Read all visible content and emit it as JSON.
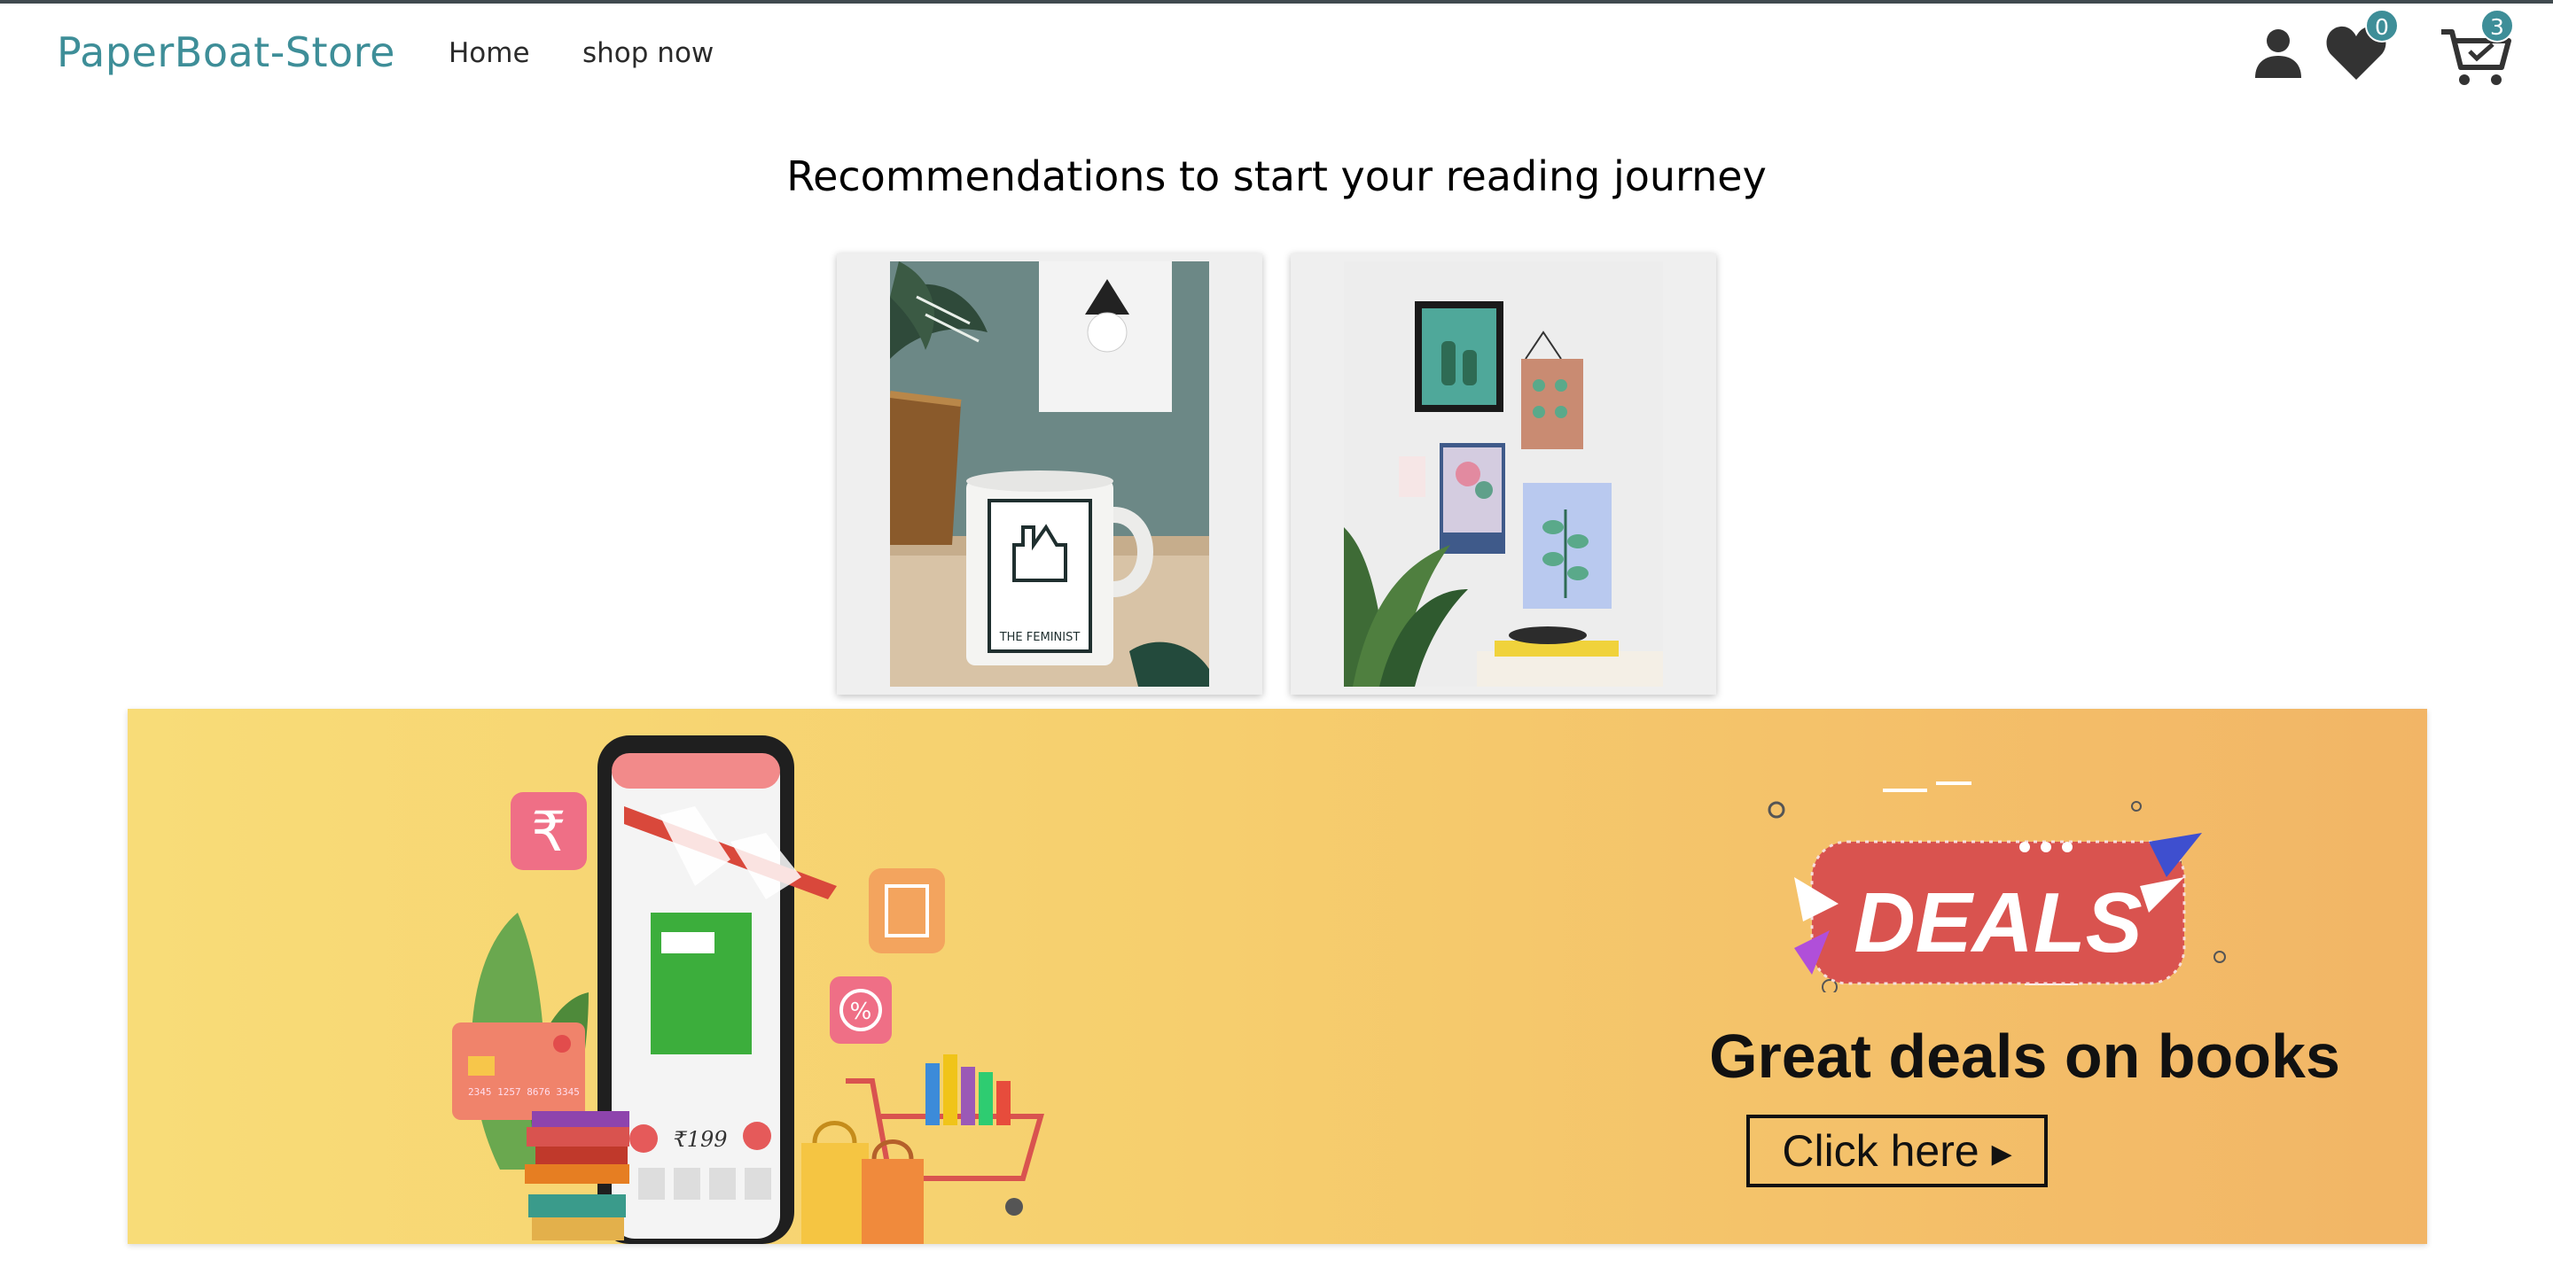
{
  "nav": {
    "brand": "PaperBoat-Store",
    "links": [
      "Home",
      "shop now"
    ],
    "wishlist_count": "0",
    "cart_count": "3",
    "icons": [
      "user-icon",
      "heart-icon",
      "cart-icon"
    ]
  },
  "recommendations": {
    "title": "Recommendations to start your reading journey",
    "items": [
      {
        "name": "mug-with-print",
        "mug_text": "THE FEMINIST"
      },
      {
        "name": "wall-art-collection"
      }
    ]
  },
  "banner": {
    "badge_text": "DEALS",
    "headline": "Great deals on books",
    "cta_label": "Click here",
    "phone_price": "₹199",
    "card_number": "2345 1257 8676 3345",
    "colors": {
      "brand": "#3e8e98",
      "badge_red": "#d9534f",
      "banner_left": "#f8dc78",
      "banner_right": "#f2b566"
    }
  }
}
